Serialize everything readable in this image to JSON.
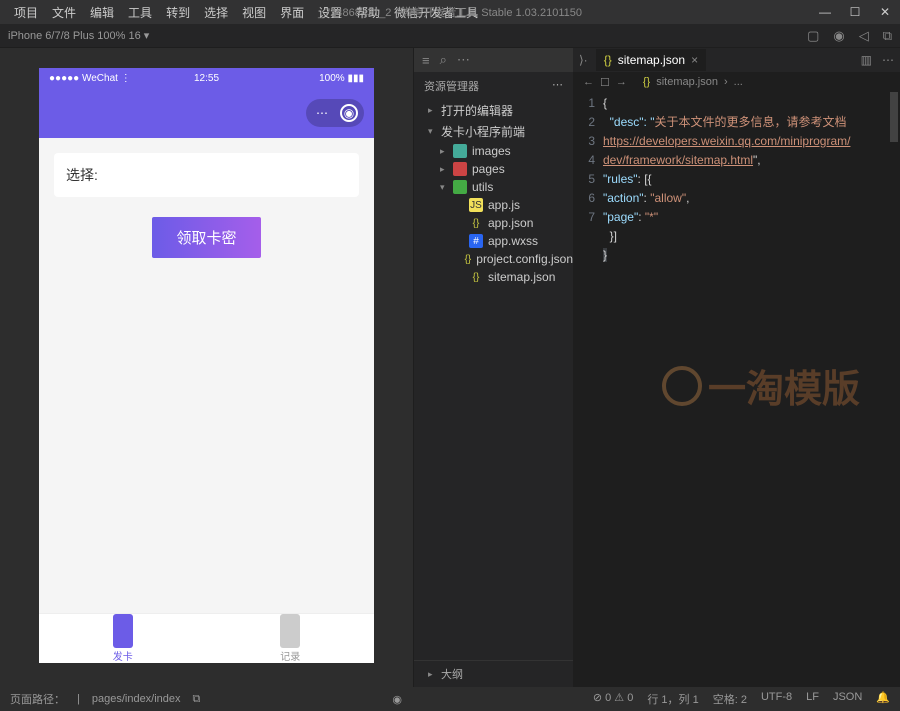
{
  "titlebar": {
    "menu": [
      "项目",
      "文件",
      "编辑",
      "工具",
      "转到",
      "选择",
      "视图",
      "界面",
      "设置",
      "帮助",
      "微信开发者工具"
    ],
    "title": "_724868431_2 - 微信开发者工具 Stable 1.03.2101150"
  },
  "toolbar": {
    "device": "iPhone 6/7/8 Plus 100% 16 ▾"
  },
  "simulator": {
    "status_left": "●●●●● WeChat ⋮",
    "status_time": "12:55",
    "status_right": "100% ▮▮▮",
    "select_label": "选择:",
    "button": "领取卡密",
    "tab1": "发卡",
    "tab2": "记录"
  },
  "explorer": {
    "header": "资源管理器",
    "items": [
      {
        "label": "打开的编辑器",
        "lvl": 0,
        "arrow": "▸"
      },
      {
        "label": "发卡小程序前端",
        "lvl": 0,
        "arrow": "▾"
      },
      {
        "label": "images",
        "lvl": 1,
        "arrow": "▸",
        "cls": "folder img"
      },
      {
        "label": "pages",
        "lvl": 1,
        "arrow": "▸",
        "cls": "folder pg"
      },
      {
        "label": "utils",
        "lvl": 1,
        "arrow": "▾",
        "cls": "folder ut"
      },
      {
        "label": "app.js",
        "lvl": 2,
        "arrow": "",
        "cls": "js",
        "glyph": "JS"
      },
      {
        "label": "app.json",
        "lvl": 2,
        "arrow": "",
        "cls": "json",
        "glyph": "{}"
      },
      {
        "label": "app.wxss",
        "lvl": 2,
        "arrow": "",
        "cls": "wxss",
        "glyph": "#"
      },
      {
        "label": "project.config.json",
        "lvl": 2,
        "arrow": "",
        "cls": "json",
        "glyph": "{}"
      },
      {
        "label": "sitemap.json",
        "lvl": 2,
        "arrow": "",
        "cls": "json",
        "glyph": "{}"
      }
    ],
    "outline": "大纲"
  },
  "editor": {
    "tab_name": "sitemap.json",
    "breadcrumb_file": "sitemap.json",
    "breadcrumb_more": "...",
    "code": {
      "l1": "{",
      "l2a": "  \"desc\": \"",
      "l2b": "关于本文件的更多信息，请参考文档",
      "l3": "https://developers.weixin.qq.com/miniprogram/",
      "l4a": "dev/framework/sitemap.html",
      "l4b": "\",",
      "l5a": "\"rules\"",
      "l5b": ": [{",
      "l6a": "\"action\"",
      "l6b": ": ",
      "l6c": "\"allow\"",
      "l6d": ",",
      "l7a": "\"page\"",
      "l7b": ": ",
      "l7c": "\"*\"",
      "l8": "  }]",
      "l9": "}"
    },
    "line_numbers": [
      "1",
      "2",
      "",
      "",
      "3",
      "4",
      "5",
      "6",
      "7"
    ]
  },
  "statusbar": {
    "path_label": "页面路径：",
    "path": "pages/index/index",
    "warn": "⊘ 0  ⚠ 0",
    "pos": "行 1，列 1",
    "spaces": "空格: 2",
    "enc": "UTF-8",
    "eol": "LF",
    "lang": "JSON"
  },
  "watermark": "一淘模版"
}
